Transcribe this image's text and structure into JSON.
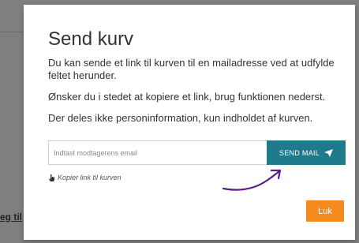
{
  "background": {
    "partial_text": "eg til"
  },
  "modal": {
    "title": "Send kurv",
    "paragraph_1": "Du kan sende et link til kurven til en mailadresse ved at udfylde feltet herunder.",
    "paragraph_2": "Ønsker du i stedet at kopiere et link, brug funktionen nederst.",
    "paragraph_3": "Der deles ikke personinformation, kun indholdet af kurven.",
    "email_placeholder": "Indtast modtagerens email",
    "email_value": "",
    "send_button_label": "SEND MAIL",
    "send_icon": "send-arrow-icon",
    "copy_link_label": "Kopier link til kurven",
    "copy_icon": "hand-pointer-icon",
    "close_button_label": "Luk",
    "annotation": "hand-drawn-arrow"
  },
  "colors": {
    "accent": "#1f7a8c",
    "close_button": "#f58a1f",
    "annotation": "#5a1f8a",
    "overlay": "#7f7f7f"
  }
}
